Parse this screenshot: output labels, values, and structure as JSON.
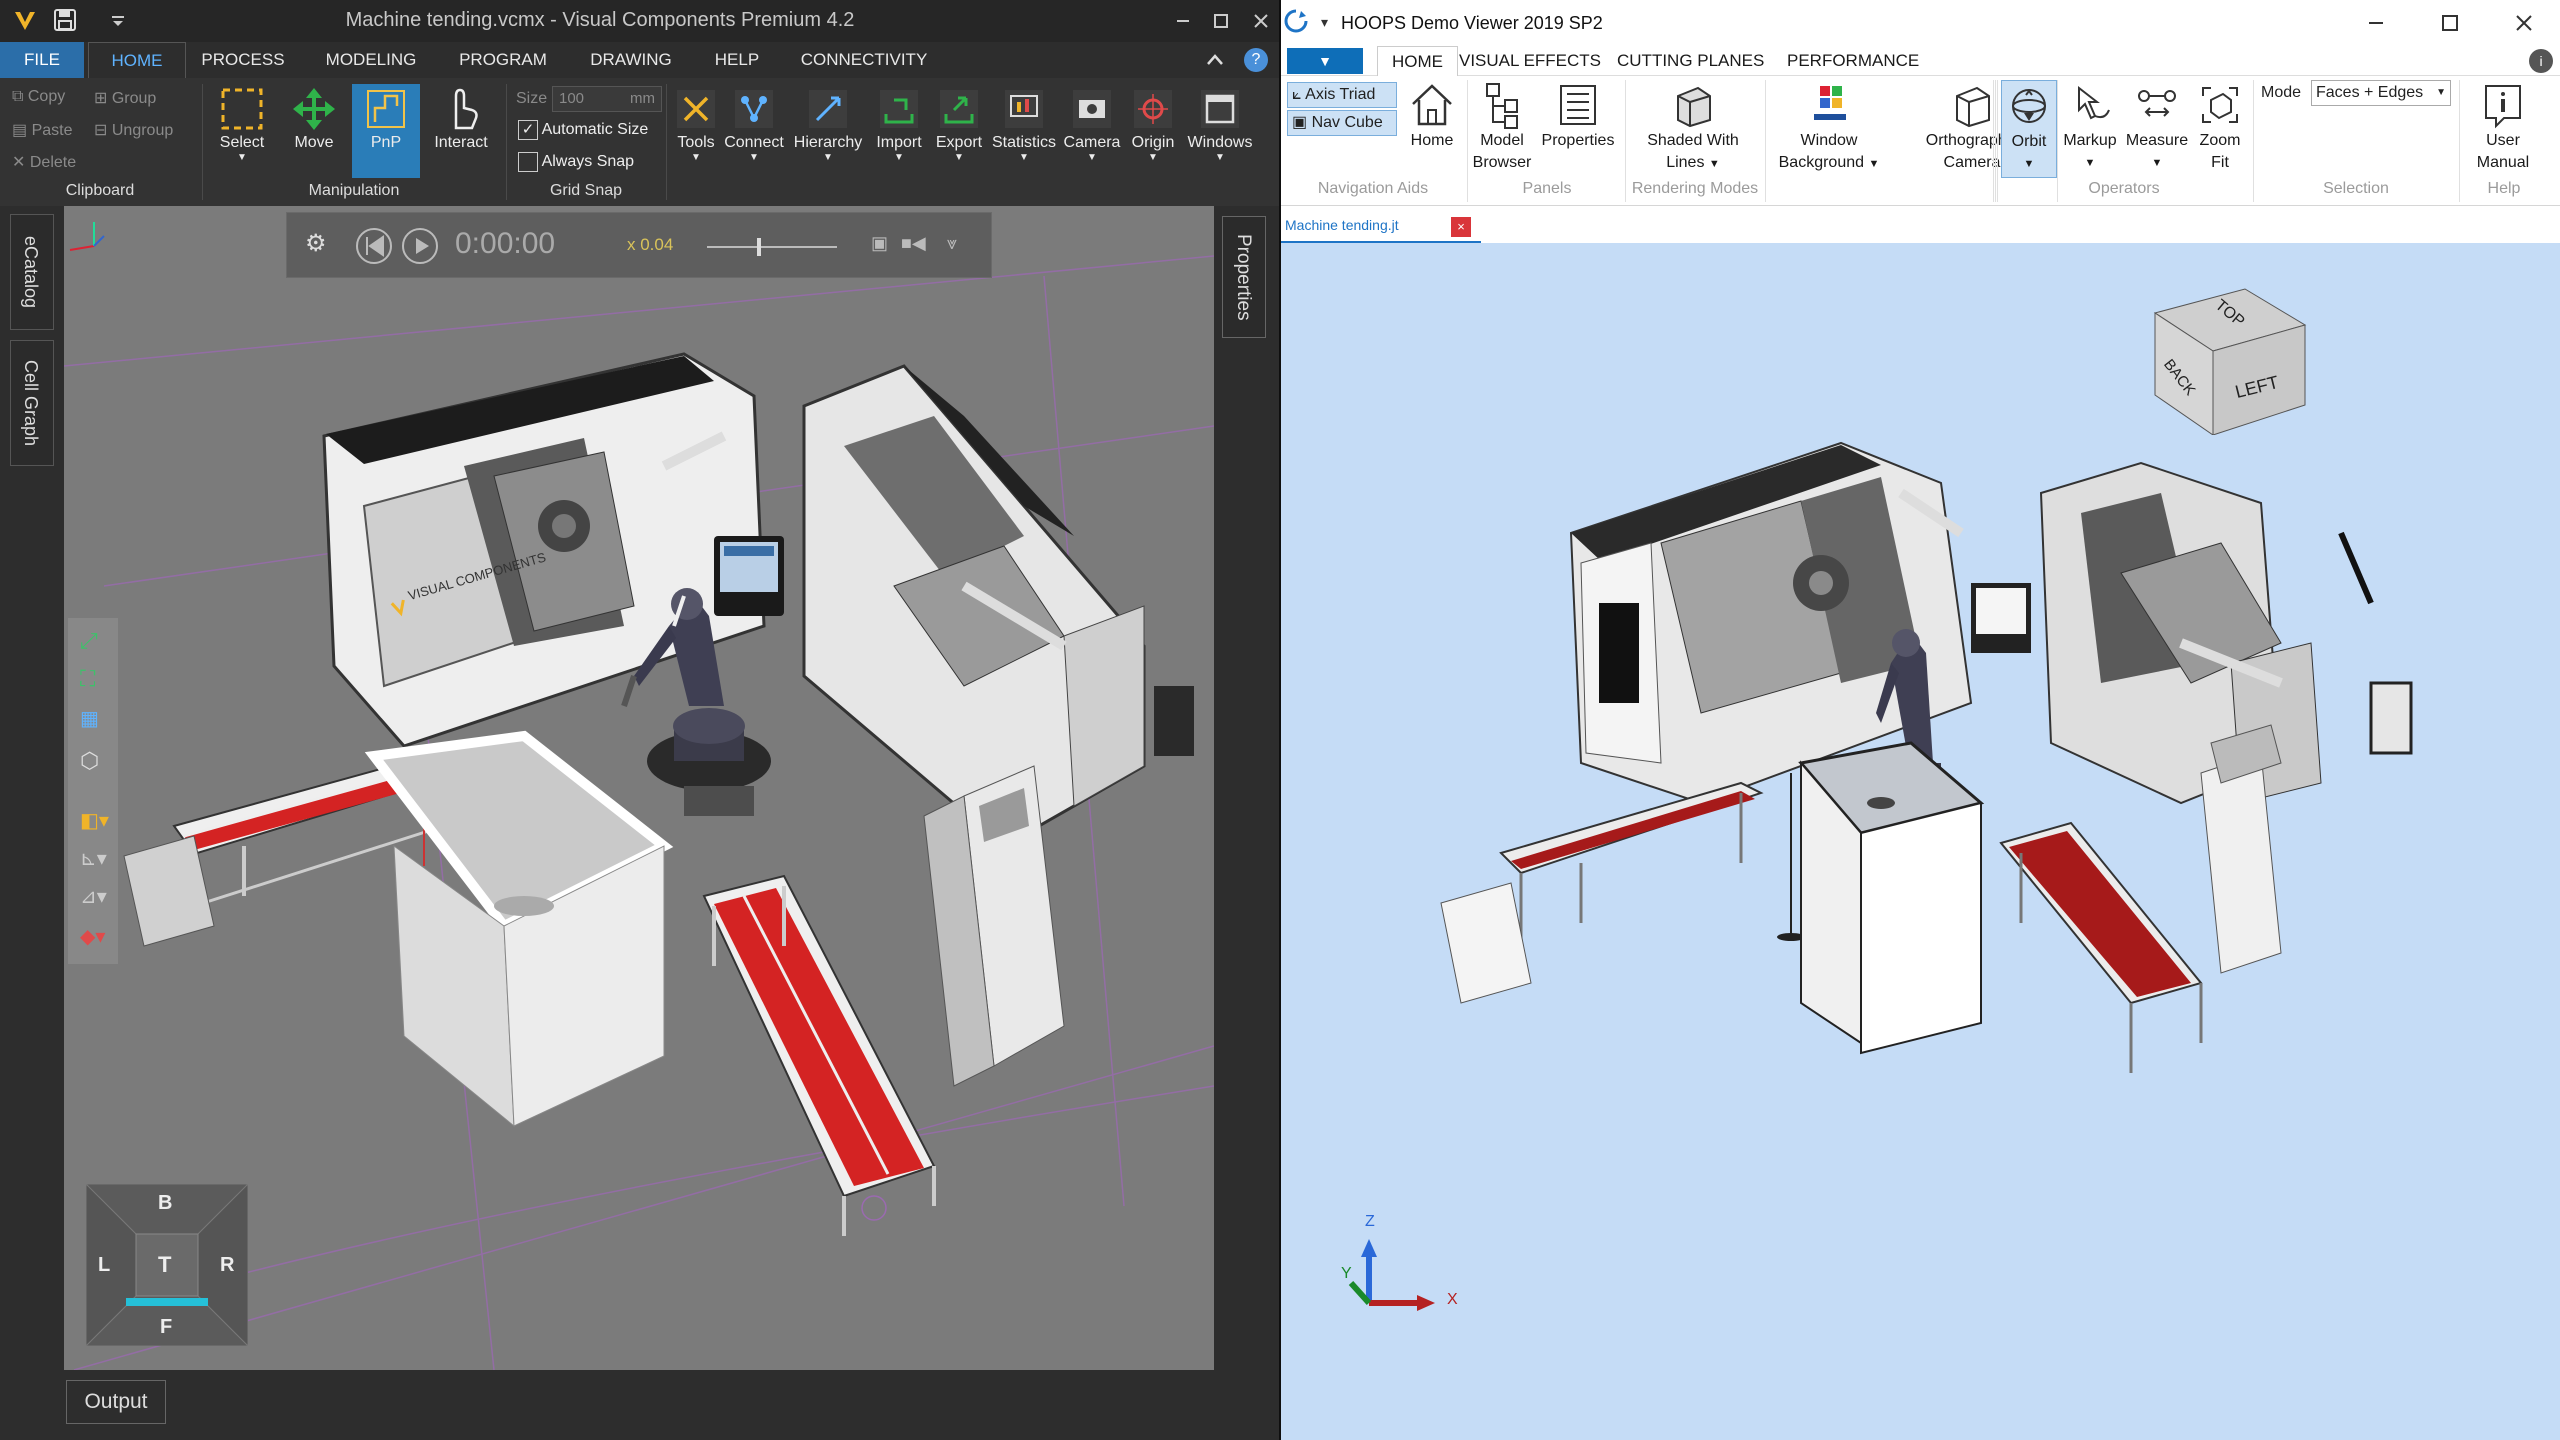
{
  "vc": {
    "title": "Machine tending.vcmx - Visual Components Premium 4.2",
    "tabs": [
      "FILE",
      "HOME",
      "PROCESS",
      "MODELING",
      "PROGRAM",
      "DRAWING",
      "HELP",
      "CONNECTIVITY"
    ],
    "clipboard": {
      "copy": "Copy",
      "paste": "Paste",
      "delete": "Delete",
      "group": "Group",
      "ungroup": "Ungroup",
      "label": "Clipboard"
    },
    "manipulation": {
      "select": "Select",
      "move": "Move",
      "pnp": "PnP",
      "interact": "Interact",
      "label": "Manipulation"
    },
    "grid_snap": {
      "size_label": "Size",
      "size_value": "100",
      "size_unit": "mm",
      "auto_size": "Automatic Size",
      "always_snap": "Always Snap",
      "label": "Grid Snap"
    },
    "tools": [
      "Tools",
      "Connect",
      "Hierarchy",
      "Import",
      "Export",
      "Statistics",
      "Camera",
      "Origin",
      "Windows"
    ],
    "side_tabs": {
      "ecatalog": "eCatalog",
      "cell_graph": "Cell Graph",
      "properties": "Properties"
    },
    "sim": {
      "time": "0:00:00",
      "speed": "x 0.04"
    },
    "nav": {
      "b": "B",
      "l": "L",
      "t": "T",
      "r": "R",
      "f": "F"
    },
    "output": "Output",
    "brand": "VISUAL COMPONENTS",
    "help_icon": "?"
  },
  "hoops": {
    "title": "HOOPS Demo Viewer 2019 SP2",
    "tabs": [
      "HOME",
      "VISUAL EFFECTS",
      "CUTTING PLANES",
      "PERFORMANCE"
    ],
    "nav_aids": {
      "axis_triad": "Axis Triad",
      "nav_cube": "Nav Cube",
      "home": "Home",
      "label": "Navigation Aids"
    },
    "panels": {
      "model_browser_1": "Model",
      "model_browser_2": "Browser",
      "properties": "Properties",
      "label": "Panels"
    },
    "rendering": {
      "shaded_1": "Shaded With",
      "shaded_2": "Lines",
      "window_bg_1": "Window",
      "window_bg_2": "Background",
      "ortho_1": "Orthographic",
      "ortho_2": "Camera",
      "label": "Rendering Modes"
    },
    "operators": {
      "orbit": "Orbit",
      "markup": "Markup",
      "measure": "Measure",
      "zoom_fit_1": "Zoom",
      "zoom_fit_2": "Fit",
      "label": "Operators"
    },
    "selection": {
      "mode_label": "Mode",
      "mode_value": "Faces + Edges",
      "label": "Selection"
    },
    "help": {
      "manual_1": "User",
      "manual_2": "Manual",
      "label": "Help"
    },
    "doc_tab": "Machine tending.jt",
    "doc_close": "×",
    "navcube": {
      "top": "TOP",
      "back": "BACK",
      "left": "LEFT"
    },
    "triad": {
      "x": "X",
      "y": "Y",
      "z": "Z"
    }
  },
  "colors": {
    "vc_accent": "#2b6ea9",
    "pnp_active": "#2a7db8",
    "hoops_accent": "#0e6eb8",
    "conveyor_red": "#d42323",
    "hoops_bg": "#c5dcf6",
    "vc_viewport": "#7b7b7b"
  }
}
